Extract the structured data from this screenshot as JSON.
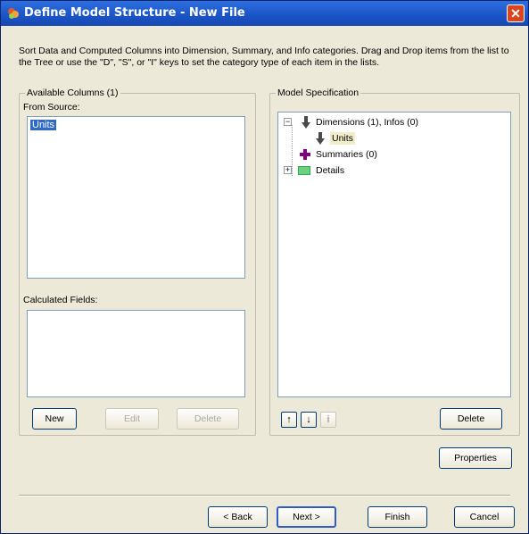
{
  "window": {
    "title": "Define Model Structure - New File"
  },
  "instructions": "Sort Data and Computed Columns into Dimension, Summary, and Info categories.  Drag and Drop items from the list to the Tree or use the \"D\", \"S\", or \"I\" keys to set the category type of each item in the lists.",
  "available_columns": {
    "group_label": "Available Columns (1)",
    "from_source_label": "From Source:",
    "source_items": [
      "Units"
    ],
    "calculated_label": "Calculated Fields:",
    "buttons": {
      "new": "New",
      "edit": "Edit",
      "delete": "Delete"
    }
  },
  "model_spec": {
    "group_label": "Model Specification",
    "tree": {
      "dimensions_label": "Dimensions (1), Infos (0)",
      "units_label": "Units",
      "summaries_label": "Summaries (0)",
      "details_label": "Details"
    },
    "buttons": {
      "up": "↑",
      "down": "↓",
      "info": "i",
      "delete": "Delete"
    }
  },
  "properties_button": "Properties",
  "footer": {
    "back": "< Back",
    "next": "Next >",
    "finish": "Finish",
    "cancel": "Cancel"
  },
  "colors": {
    "titlebar": "#1b54c7",
    "selection": "#316ac5",
    "dimension_icon": "#4a4a4a",
    "summary_icon": "#800080",
    "details_icon": "#2fa84f",
    "close": "#d9451e"
  }
}
